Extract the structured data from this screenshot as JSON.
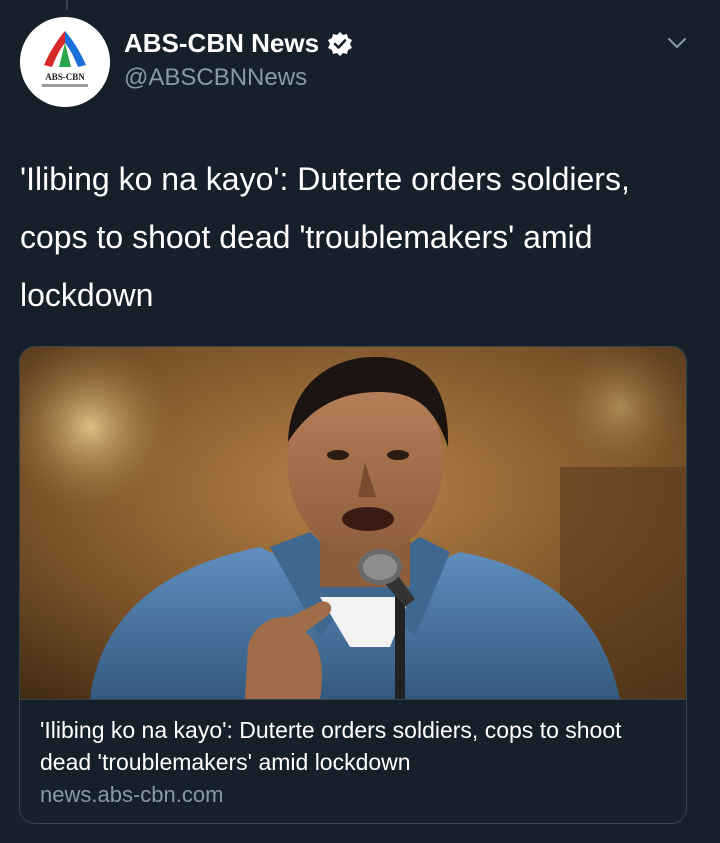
{
  "tweet": {
    "author": {
      "display_name": "ABS-CBN News",
      "handle": "@ABSCBNNews",
      "verified": true,
      "avatar_icon": "abs-cbn-logo",
      "avatar_logo_text": "ABS-CBN"
    },
    "text": "'Ilibing ko na kayo': Duterte orders soldiers, cops to shoot dead 'troublemakers' amid lockdown",
    "menu_icon": "chevron-down-icon"
  },
  "card": {
    "image_subject": "photo-man-speaking-at-microphone",
    "title": "'Ilibing ko na kayo': Duterte orders soldiers, cops to shoot dead 'troublemakers' amid lockdown",
    "domain": "news.abs-cbn.com"
  },
  "colors": {
    "background": "#15202b",
    "border": "#38444d",
    "secondary_text": "#8899a6",
    "verified": "#ffffff"
  }
}
